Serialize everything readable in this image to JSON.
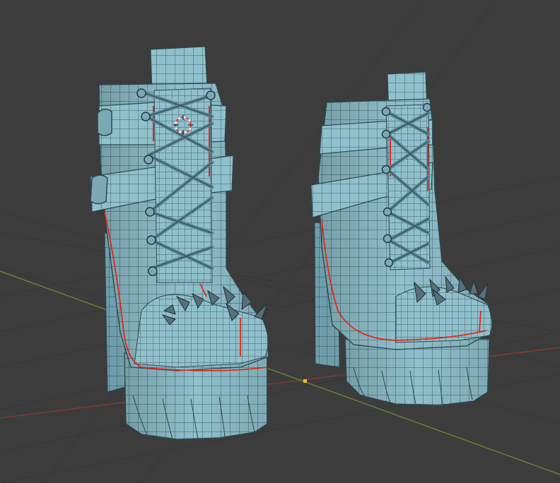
{
  "viewport": {
    "background": "#3c3c3c",
    "grid_color": "#353535",
    "x_axis_color": "#8a3a3a",
    "y_axis_color": "#6a8a32",
    "origin_color": "#f0c000"
  },
  "scene": {
    "objects": [
      {
        "name": "boot-left",
        "parts": [
          "shaft",
          "straps",
          "laces",
          "eyelets",
          "spikes",
          "toe",
          "heel",
          "platform-sole",
          "seams"
        ]
      },
      {
        "name": "boot-right",
        "parts": [
          "shaft",
          "straps",
          "laces",
          "eyelets",
          "spikes",
          "toe",
          "heel",
          "platform-sole",
          "seams"
        ]
      }
    ],
    "mesh_color": "#8fc0cc",
    "wire_color": "#35505a",
    "seam_color": "#e02a1a",
    "cursor_color": "#e83c28"
  }
}
